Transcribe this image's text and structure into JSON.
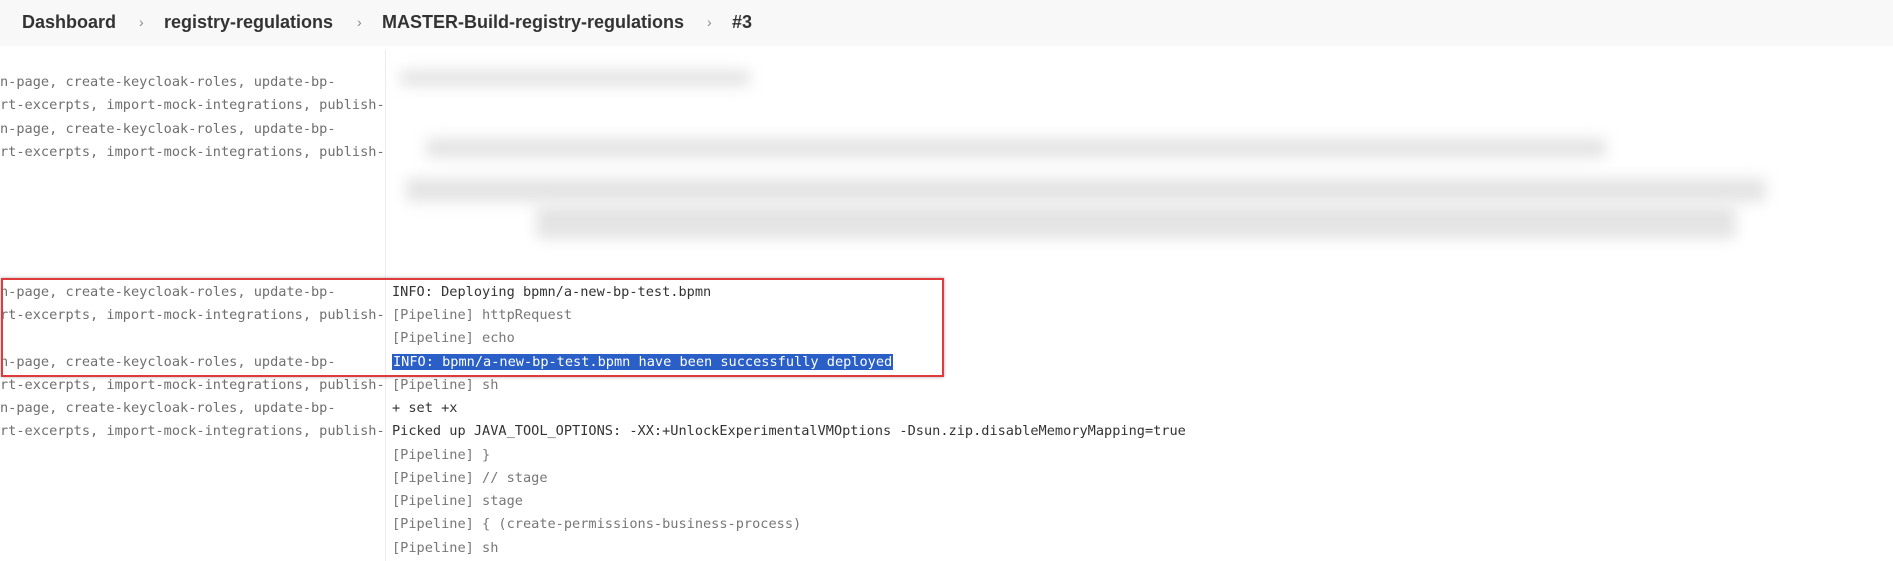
{
  "breadcrumb": {
    "items": [
      "Dashboard",
      "registry-regulations",
      "MASTER-Build-registry-regulations",
      "#3"
    ],
    "separator": "›"
  },
  "left_lines": [
    "n-page, create-keycloak-roles, update-bp-",
    "rt-excerpts, import-mock-integrations, publish-",
    "n-page, create-keycloak-roles, update-bp-",
    "rt-excerpts, import-mock-integrations, publish-",
    "n-page, create-keycloak-roles, update-bp-",
    "rt-excerpts, import-mock-integrations, publish-",
    "n-page, create-keycloak-roles, update-bp-",
    "rt-excerpts, import-mock-integrations, publish-",
    "n-page, create-keycloak-roles, update-bp-",
    "rt-excerpts, import-mock-integrations, publish-"
  ],
  "console": {
    "line_1": "INFO: Deploying bpmn/a-new-bp-test.bpmn",
    "line_2": "[Pipeline] httpRequest",
    "line_3": "[Pipeline] echo",
    "line_4": "INFO: bpmn/a-new-bp-test.bpmn have been successfully deployed",
    "line_5": "[Pipeline] sh",
    "line_6": "+ set +x",
    "line_7": "Picked up JAVA_TOOL_OPTIONS: -XX:+UnlockExperimentalVMOptions -Dsun.zip.disableMemoryMapping=true",
    "line_8": "[Pipeline] }",
    "line_9": "[Pipeline] // stage",
    "line_10": "[Pipeline] stage",
    "line_11": "[Pipeline] { (create-permissions-business-process)",
    "line_12": "[Pipeline] sh"
  },
  "colors": {
    "highlight": "#2a5fc7",
    "annotation_box": "#e03a3a"
  }
}
